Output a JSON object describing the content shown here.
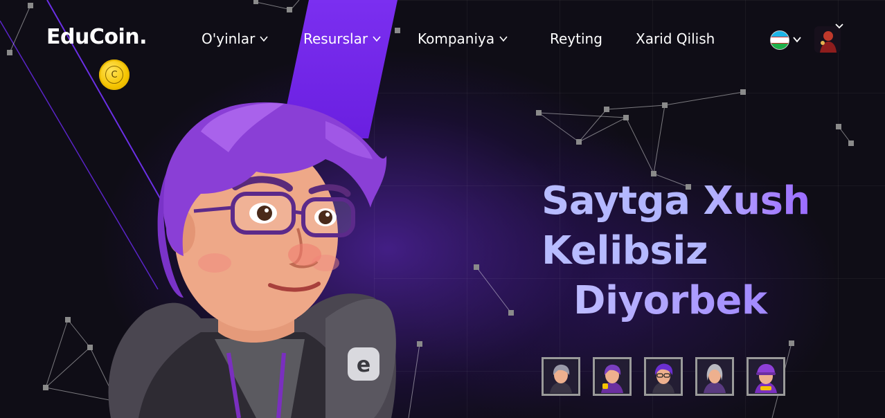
{
  "brand": {
    "name": "EduCoin.",
    "coin_letter": "C",
    "coin_color": "#f5c400"
  },
  "nav": {
    "items": [
      {
        "label": "O'yinlar",
        "has_dropdown": true
      },
      {
        "label": "Resurslar",
        "has_dropdown": true
      },
      {
        "label": "Kompaniya",
        "has_dropdown": true
      },
      {
        "label": "Reyting",
        "has_dropdown": false
      },
      {
        "label": "Xarid Qilish",
        "has_dropdown": false
      }
    ]
  },
  "language": {
    "flag": "uzbekistan-flag-icon"
  },
  "user": {
    "avatar": "user-avatar"
  },
  "hero": {
    "line1a": "Saytga",
    "line1b": "Xush",
    "line2": "Kelibsiz",
    "line3": "Diyorbek"
  },
  "avatars": [
    {
      "name": "avatar-option-1",
      "hair": "#9a9aa8"
    },
    {
      "name": "avatar-option-2",
      "hair": "#7a3fbf"
    },
    {
      "name": "avatar-option-3",
      "hair": "#6b2fd0"
    },
    {
      "name": "avatar-option-4",
      "hair": "#b8b8c0"
    },
    {
      "name": "avatar-option-5",
      "hair": "#8e3fd6"
    }
  ],
  "colors": {
    "accent": "#7b2ff0",
    "background": "#0f0d16",
    "headline": "#a989ff"
  }
}
